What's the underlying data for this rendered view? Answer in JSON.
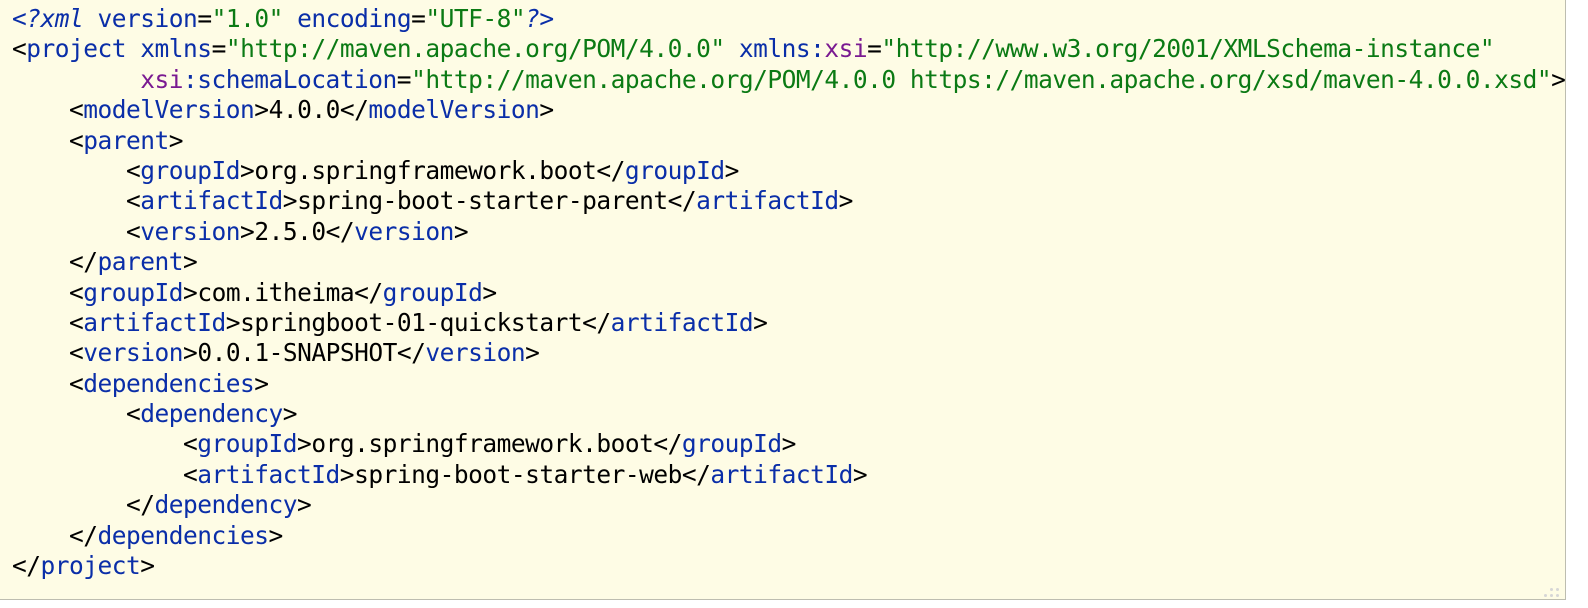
{
  "editor": {
    "language": "xml",
    "colors": {
      "background": "#fefce5",
      "tag": "#0a2ea8",
      "namespace": "#7a1a91",
      "value": "#0b7a14",
      "text": "#000000"
    },
    "lines": [
      [
        {
          "t": "pi",
          "v": "<?"
        },
        {
          "t": "pi",
          "v": "xml"
        },
        {
          "t": "text",
          "v": " "
        },
        {
          "t": "attr",
          "v": "version"
        },
        {
          "t": "eq",
          "v": "="
        },
        {
          "t": "value",
          "v": "\"1.0\""
        },
        {
          "t": "text",
          "v": " "
        },
        {
          "t": "attr",
          "v": "encoding"
        },
        {
          "t": "eq",
          "v": "="
        },
        {
          "t": "value",
          "v": "\"UTF-8\""
        },
        {
          "t": "pi",
          "v": "?>"
        }
      ],
      [
        {
          "t": "bracket",
          "v": "<"
        },
        {
          "t": "tag",
          "v": "project"
        },
        {
          "t": "text",
          "v": " "
        },
        {
          "t": "attr",
          "v": "xmlns"
        },
        {
          "t": "eq",
          "v": "="
        },
        {
          "t": "value",
          "v": "\"http://maven.apache.org/POM/4.0.0\""
        },
        {
          "t": "text",
          "v": " "
        },
        {
          "t": "attr",
          "v": "xmlns:"
        },
        {
          "t": "ns",
          "v": "xsi"
        },
        {
          "t": "eq",
          "v": "="
        },
        {
          "t": "value",
          "v": "\"http://www.w3.org/2001/XMLSchema-instance\""
        }
      ],
      [
        {
          "t": "text",
          "v": "         "
        },
        {
          "t": "ns",
          "v": "xsi"
        },
        {
          "t": "attr",
          "v": ":schemaLocation"
        },
        {
          "t": "eq",
          "v": "="
        },
        {
          "t": "value",
          "v": "\"http://maven.apache.org/POM/4.0.0 https://maven.apache.org/xsd/maven-4.0.0.xsd\""
        },
        {
          "t": "bracket",
          "v": ">"
        }
      ],
      [
        {
          "t": "text",
          "v": "    "
        },
        {
          "t": "bracket",
          "v": "<"
        },
        {
          "t": "tag",
          "v": "modelVersion"
        },
        {
          "t": "bracket",
          "v": ">"
        },
        {
          "t": "text",
          "v": "4.0.0"
        },
        {
          "t": "bracket",
          "v": "</"
        },
        {
          "t": "tag",
          "v": "modelVersion"
        },
        {
          "t": "bracket",
          "v": ">"
        }
      ],
      [
        {
          "t": "text",
          "v": "    "
        },
        {
          "t": "bracket",
          "v": "<"
        },
        {
          "t": "tag",
          "v": "parent"
        },
        {
          "t": "bracket",
          "v": ">"
        }
      ],
      [
        {
          "t": "text",
          "v": "        "
        },
        {
          "t": "bracket",
          "v": "<"
        },
        {
          "t": "tag",
          "v": "groupId"
        },
        {
          "t": "bracket",
          "v": ">"
        },
        {
          "t": "text",
          "v": "org.springframework.boot"
        },
        {
          "t": "bracket",
          "v": "</"
        },
        {
          "t": "tag",
          "v": "groupId"
        },
        {
          "t": "bracket",
          "v": ">"
        }
      ],
      [
        {
          "t": "text",
          "v": "        "
        },
        {
          "t": "bracket",
          "v": "<"
        },
        {
          "t": "tag",
          "v": "artifactId"
        },
        {
          "t": "bracket",
          "v": ">"
        },
        {
          "t": "text",
          "v": "spring-boot-starter-parent"
        },
        {
          "t": "bracket",
          "v": "</"
        },
        {
          "t": "tag",
          "v": "artifactId"
        },
        {
          "t": "bracket",
          "v": ">"
        }
      ],
      [
        {
          "t": "text",
          "v": "        "
        },
        {
          "t": "bracket",
          "v": "<"
        },
        {
          "t": "tag",
          "v": "version"
        },
        {
          "t": "bracket",
          "v": ">"
        },
        {
          "t": "text",
          "v": "2.5.0"
        },
        {
          "t": "bracket",
          "v": "</"
        },
        {
          "t": "tag",
          "v": "version"
        },
        {
          "t": "bracket",
          "v": ">"
        }
      ],
      [
        {
          "t": "text",
          "v": "    "
        },
        {
          "t": "bracket",
          "v": "</"
        },
        {
          "t": "tag",
          "v": "parent"
        },
        {
          "t": "bracket",
          "v": ">"
        }
      ],
      [
        {
          "t": "text",
          "v": "    "
        },
        {
          "t": "bracket",
          "v": "<"
        },
        {
          "t": "tag",
          "v": "groupId"
        },
        {
          "t": "bracket",
          "v": ">"
        },
        {
          "t": "text",
          "v": "com.itheima"
        },
        {
          "t": "bracket",
          "v": "</"
        },
        {
          "t": "tag",
          "v": "groupId"
        },
        {
          "t": "bracket",
          "v": ">"
        }
      ],
      [
        {
          "t": "text",
          "v": "    "
        },
        {
          "t": "bracket",
          "v": "<"
        },
        {
          "t": "tag",
          "v": "artifactId"
        },
        {
          "t": "bracket",
          "v": ">"
        },
        {
          "t": "text",
          "v": "springboot-01-quickstart"
        },
        {
          "t": "bracket",
          "v": "</"
        },
        {
          "t": "tag",
          "v": "artifactId"
        },
        {
          "t": "bracket",
          "v": ">"
        }
      ],
      [
        {
          "t": "text",
          "v": "    "
        },
        {
          "t": "bracket",
          "v": "<"
        },
        {
          "t": "tag",
          "v": "version"
        },
        {
          "t": "bracket",
          "v": ">"
        },
        {
          "t": "text",
          "v": "0.0.1-SNAPSHOT"
        },
        {
          "t": "bracket",
          "v": "</"
        },
        {
          "t": "tag",
          "v": "version"
        },
        {
          "t": "bracket",
          "v": ">"
        }
      ],
      [
        {
          "t": "text",
          "v": "    "
        },
        {
          "t": "bracket",
          "v": "<"
        },
        {
          "t": "tag",
          "v": "dependencies"
        },
        {
          "t": "bracket",
          "v": ">"
        }
      ],
      [
        {
          "t": "text",
          "v": "        "
        },
        {
          "t": "bracket",
          "v": "<"
        },
        {
          "t": "tag",
          "v": "dependency"
        },
        {
          "t": "bracket",
          "v": ">"
        }
      ],
      [
        {
          "t": "text",
          "v": "            "
        },
        {
          "t": "bracket",
          "v": "<"
        },
        {
          "t": "tag",
          "v": "groupId"
        },
        {
          "t": "bracket",
          "v": ">"
        },
        {
          "t": "text",
          "v": "org.springframework.boot"
        },
        {
          "t": "bracket",
          "v": "</"
        },
        {
          "t": "tag",
          "v": "groupId"
        },
        {
          "t": "bracket",
          "v": ">"
        }
      ],
      [
        {
          "t": "text",
          "v": "            "
        },
        {
          "t": "bracket",
          "v": "<"
        },
        {
          "t": "tag",
          "v": "artifactId"
        },
        {
          "t": "bracket",
          "v": ">"
        },
        {
          "t": "text",
          "v": "spring-boot-starter-web"
        },
        {
          "t": "bracket",
          "v": "</"
        },
        {
          "t": "tag",
          "v": "artifactId"
        },
        {
          "t": "bracket",
          "v": ">"
        }
      ],
      [
        {
          "t": "text",
          "v": "        "
        },
        {
          "t": "bracket",
          "v": "</"
        },
        {
          "t": "tag",
          "v": "dependency"
        },
        {
          "t": "bracket",
          "v": ">"
        }
      ],
      [
        {
          "t": "text",
          "v": "    "
        },
        {
          "t": "bracket",
          "v": "</"
        },
        {
          "t": "tag",
          "v": "dependencies"
        },
        {
          "t": "bracket",
          "v": ">"
        }
      ],
      [
        {
          "t": "bracket",
          "v": "</"
        },
        {
          "t": "tag",
          "v": "project"
        },
        {
          "t": "bracket",
          "v": ">"
        }
      ]
    ]
  }
}
